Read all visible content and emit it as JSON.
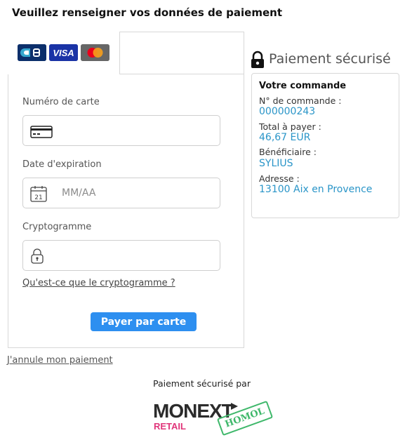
{
  "header": {
    "title": "Veuillez renseigner vos données de paiement"
  },
  "card_brands": [
    {
      "name": "CB",
      "color": "#0c2f6b"
    },
    {
      "name": "VISA",
      "color": "#1a33a6"
    },
    {
      "name": "Mastercard",
      "color": "#666666"
    }
  ],
  "form": {
    "card_number_label": "Numéro de carte",
    "expiry_label": "Date d'expiration",
    "expiry_placeholder": "MM/AA",
    "expiry_icon_day": "21",
    "cvv_label": "Cryptogramme",
    "cvv_help_link": "Qu'est-ce que le cryptogramme ?",
    "pay_button": "Payer par carte",
    "pay_button_color": "#2d8ff0"
  },
  "secure": {
    "title": "Paiement sécurisé"
  },
  "order": {
    "heading": "Votre commande",
    "order_number_label": "N° de commande :",
    "order_number": "000000243",
    "total_label": "Total à payer :",
    "total": "46,67 EUR",
    "beneficiary_label": "Bénéficiaire :",
    "beneficiary": "SYLIUS",
    "address_label": "Adresse :",
    "address": "13100 Aix en Provence",
    "value_color": "#2a95c8"
  },
  "footer": {
    "cancel_link": "J'annule mon paiement",
    "secured_by": "Paiement sécurisé par",
    "logo_main": "MONEXT",
    "logo_sub": "RETAIL",
    "stamp": "HOMOL"
  }
}
